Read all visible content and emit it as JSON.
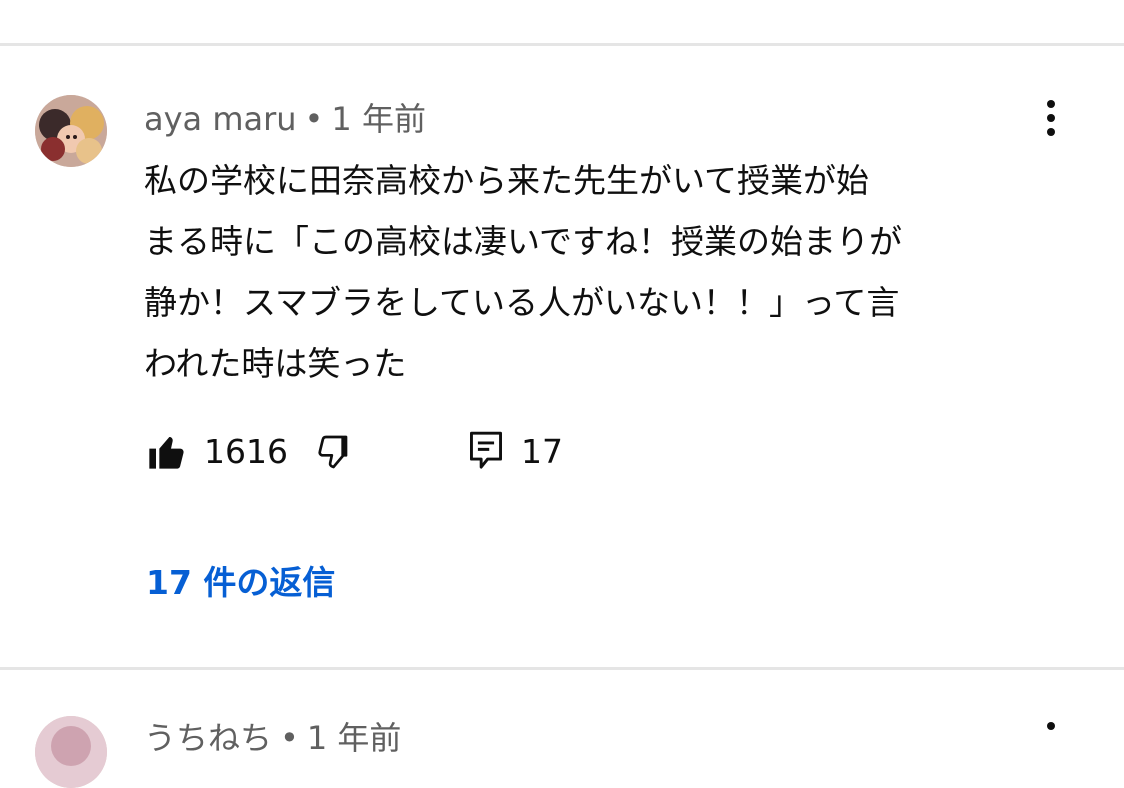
{
  "comment": {
    "author": "aya maru",
    "separator": "•",
    "time": "1 年前",
    "text_lines": [
      "私の学校に田奈高校から来た先生がいて授業が始",
      "まる時に「この高校は凄いですね！授業の始まりが",
      "静か！スマブラをしている人がいない！！」って言",
      "われた時は笑った"
    ],
    "like_count": "1616",
    "reply_count": "17",
    "replies_link": "17 件の返信"
  },
  "next_comment": {
    "author": "うちねち",
    "separator": "•",
    "time": "1 年前"
  },
  "colors": {
    "link": "#065fd4",
    "meta": "#606060",
    "text": "#0f0f0f",
    "divider": "#e5e5e5"
  },
  "icons": [
    "avatar-image",
    "more-vert-icon",
    "thumb-up-filled-icon",
    "thumb-down-outline-icon",
    "comment-reply-icon"
  ]
}
